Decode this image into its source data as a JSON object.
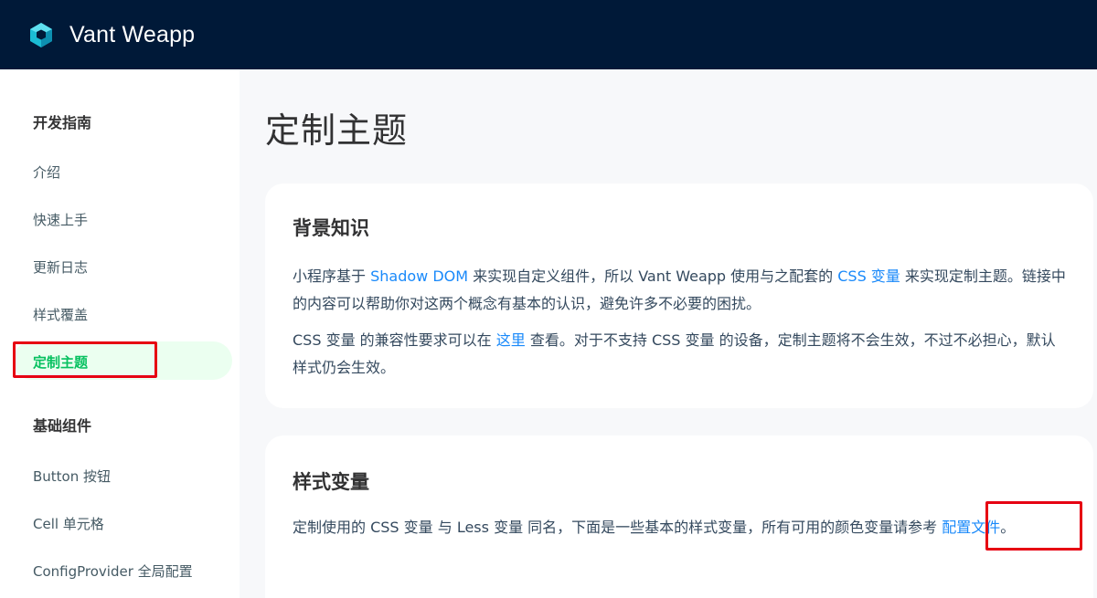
{
  "header": {
    "brand": "Vant Weapp"
  },
  "sidebar": {
    "group1_title": "开发指南",
    "group1_items": [
      "介绍",
      "快速上手",
      "更新日志",
      "样式覆盖",
      "定制主题"
    ],
    "group2_title": "基础组件",
    "group2_items": [
      "Button 按钮",
      "Cell 单元格",
      "ConfigProvider 全局配置"
    ]
  },
  "main": {
    "title": "定制主题",
    "card1": {
      "heading": "背景知识",
      "p1_a": "小程序基于 ",
      "p1_link1": "Shadow DOM",
      "p1_b": " 来实现自定义组件，所以 Vant Weapp 使用与之配套的 ",
      "p1_link2": "CSS 变量",
      "p1_c": " 来实现定制主题。链接中的内容可以帮助你对这两个概念有基本的认识，避免许多不必要的困扰。",
      "p2_a": "CSS 变量 的兼容性要求可以在 ",
      "p2_link": "这里",
      "p2_b": " 查看。对于不支持 CSS 变量 的设备，定制主题将不会生效，不过不必担心，默认样式仍会生效。"
    },
    "card2": {
      "heading": "样式变量",
      "p1_a": "定制使用的 CSS 变量 与 Less 变量 同名，下面是一些基本的样式变量，所有可用的颜色变量请参考 ",
      "p1_link": "配置文件",
      "p1_b": "。"
    }
  },
  "colors": {
    "header_bg": "#001938",
    "active_green": "#07c160",
    "link_blue": "#1989fa",
    "highlight_red": "#e60012"
  }
}
